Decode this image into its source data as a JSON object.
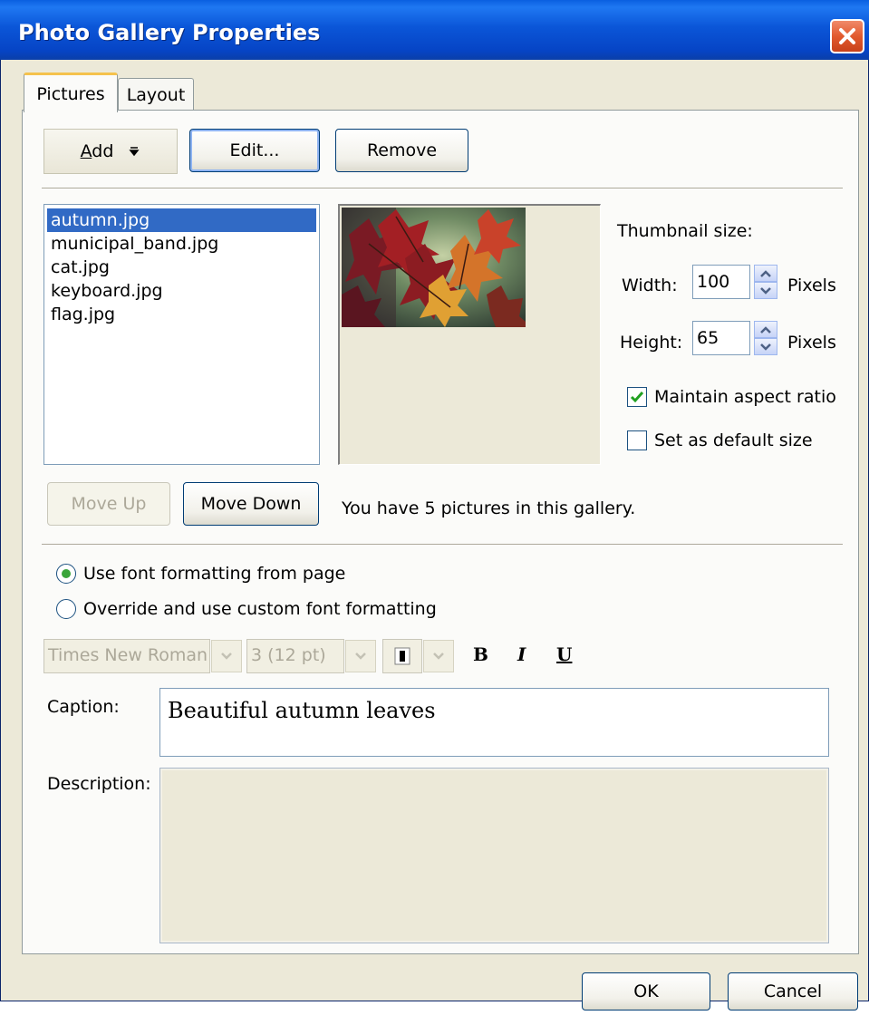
{
  "window": {
    "title": "Photo Gallery Properties"
  },
  "tabs": [
    {
      "label": "Pictures",
      "active": true
    },
    {
      "label": "Layout",
      "active": false
    }
  ],
  "toolbar": {
    "add_label": "Add",
    "add_accesskey": "A",
    "edit_label": "Edit...",
    "remove_label": "Remove"
  },
  "pictures": {
    "items": [
      "autumn.jpg",
      "municipal_band.jpg",
      "cat.jpg",
      "keyboard.jpg",
      "flag.jpg"
    ],
    "selected": "autumn.jpg"
  },
  "thumbnail": {
    "heading": "Thumbnail size:",
    "width_label": "Width:",
    "width_value": "100",
    "width_unit": "Pixels",
    "height_label": "Height:",
    "height_value": "65",
    "height_unit": "Pixels",
    "maintain_aspect_label": "Maintain aspect ratio",
    "maintain_aspect_checked": true,
    "default_size_label": "Set as default size",
    "default_size_checked": false
  },
  "move": {
    "up_label": "Move Up",
    "up_enabled": false,
    "down_label": "Move Down"
  },
  "gallery_count_text": "You have 5 pictures in this gallery.",
  "font_options": {
    "use_page_label": "Use font formatting from page",
    "override_label": "Override and use custom font formatting",
    "selected": "use_page"
  },
  "formatting": {
    "font_name": "Times New Roman",
    "font_size": "3  (12 pt)",
    "bold_label": "B",
    "italic_label": "I",
    "underline_label": "U"
  },
  "caption": {
    "label": "Caption:",
    "value": "Beautiful autumn leaves"
  },
  "description": {
    "label": "Description:",
    "value": ""
  },
  "footer": {
    "ok_label": "OK",
    "cancel_label": "Cancel"
  },
  "colors": {
    "title_bar": "#0a56d8",
    "selection": "#316ac5",
    "dialog_bg": "#ece9d8",
    "close_button": "#e25a2e"
  }
}
